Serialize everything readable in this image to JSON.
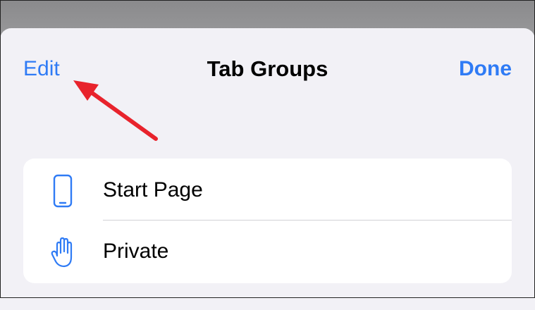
{
  "nav": {
    "edit_label": "Edit",
    "title": "Tab Groups",
    "done_label": "Done"
  },
  "tab_groups": [
    {
      "label": "Start Page",
      "icon": "iphone-icon"
    },
    {
      "label": "Private",
      "icon": "hand-raised-icon"
    }
  ],
  "colors": {
    "accent": "#2f7bf5",
    "annotation_arrow": "#e8232c",
    "sheet_background": "#f2f1f6",
    "list_background": "#ffffff"
  }
}
